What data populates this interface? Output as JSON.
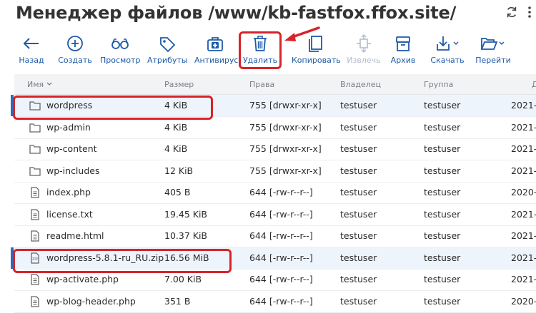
{
  "header": {
    "title": "Менеджер файлов /www/kb-fastfox.ffox.site/"
  },
  "toolbar": {
    "back": "Назад",
    "create": "Создать",
    "view": "Просмотр",
    "attributes": "Атрибуты",
    "antivirus": "Антивирус",
    "delete": "Удалить",
    "copy": "Копировать",
    "extract": "Извлечь",
    "archive": "Архив",
    "download": "Скачать",
    "goto": "Перейти"
  },
  "table": {
    "columns": {
      "name": "Имя",
      "size": "Размер",
      "permissions": "Права",
      "owner": "Владелец",
      "group": "Группа",
      "date": "Д"
    },
    "rows": [
      {
        "icon": "folder-icon",
        "name": "wordpress",
        "size": "4 KiB",
        "perm": "755 [drwxr-xr-x]",
        "owner": "testuser",
        "group": "testuser",
        "date": "2021-0"
      },
      {
        "icon": "folder-icon",
        "name": "wp-admin",
        "size": "4 KiB",
        "perm": "755 [drwxr-xr-x]",
        "owner": "testuser",
        "group": "testuser",
        "date": "2021-0"
      },
      {
        "icon": "folder-icon",
        "name": "wp-content",
        "size": "4 KiB",
        "perm": "755 [drwxr-xr-x]",
        "owner": "testuser",
        "group": "testuser",
        "date": "2021-0"
      },
      {
        "icon": "folder-icon",
        "name": "wp-includes",
        "size": "12 KiB",
        "perm": "755 [drwxr-xr-x]",
        "owner": "testuser",
        "group": "testuser",
        "date": "2021-0"
      },
      {
        "icon": "file-icon",
        "name": "index.php",
        "size": "405 B",
        "perm": "644 [-rw-r--r--]",
        "owner": "testuser",
        "group": "testuser",
        "date": "2020-0"
      },
      {
        "icon": "file-icon",
        "name": "license.txt",
        "size": "19.45 KiB",
        "perm": "644 [-rw-r--r--]",
        "owner": "testuser",
        "group": "testuser",
        "date": "2021-0"
      },
      {
        "icon": "file-icon",
        "name": "readme.html",
        "size": "10.37 KiB",
        "perm": "644 [-rw-r--r--]",
        "owner": "testuser",
        "group": "testuser",
        "date": "2021-0"
      },
      {
        "icon": "zip-icon",
        "name": "wordpress-5.8.1-ru_RU.zip",
        "size": "16.56 MiB",
        "perm": "644 [-rw-r--r--]",
        "owner": "testuser",
        "group": "testuser",
        "date": "2021-0"
      },
      {
        "icon": "file-icon",
        "name": "wp-activate.php",
        "size": "7.00 KiB",
        "perm": "644 [-rw-r--r--]",
        "owner": "testuser",
        "group": "testuser",
        "date": "2021-0"
      },
      {
        "icon": "file-icon",
        "name": "wp-blog-header.php",
        "size": "351 B",
        "perm": "644 [-rw-r--r--]",
        "owner": "testuser",
        "group": "testuser",
        "date": "2020-0"
      }
    ]
  },
  "colors": {
    "accent": "#1e5aa8",
    "disabled": "#b2bccb",
    "highlight": "#d8232a",
    "selection": "#eef4fc"
  }
}
